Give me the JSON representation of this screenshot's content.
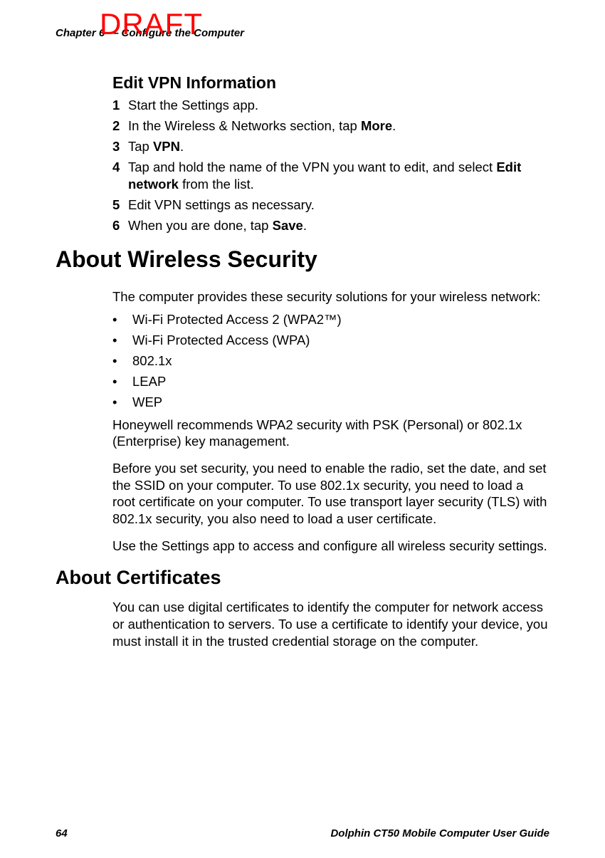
{
  "watermark": "DRAFT",
  "chapter_header": "Chapter 6 — Configure the Computer",
  "section1": {
    "heading": "Edit VPN Information",
    "steps": [
      {
        "num": "1",
        "segments": [
          {
            "t": "Start the Settings app."
          }
        ]
      },
      {
        "num": "2",
        "segments": [
          {
            "t": "In the Wireless & Networks section, tap "
          },
          {
            "t": "More",
            "b": true
          },
          {
            "t": "."
          }
        ]
      },
      {
        "num": "3",
        "segments": [
          {
            "t": "Tap "
          },
          {
            "t": "VPN",
            "b": true
          },
          {
            "t": "."
          }
        ]
      },
      {
        "num": "4",
        "segments": [
          {
            "t": "Tap and hold the name of the VPN you want to edit, and select "
          },
          {
            "t": "Edit network",
            "b": true
          },
          {
            "t": " from the list."
          }
        ]
      },
      {
        "num": "5",
        "segments": [
          {
            "t": "Edit VPN settings as necessary."
          }
        ]
      },
      {
        "num": "6",
        "segments": [
          {
            "t": "When you are done, tap "
          },
          {
            "t": "Save",
            "b": true
          },
          {
            "t": "."
          }
        ]
      }
    ]
  },
  "section2": {
    "heading": "About Wireless Security",
    "intro": "The computer provides these security solutions for your wireless network:",
    "bullets": [
      "Wi-Fi Protected Access 2 (WPA2™)",
      "Wi-Fi Protected Access (WPA)",
      "802.1x",
      "LEAP",
      "WEP"
    ],
    "para1": "Honeywell recommends WPA2 security with PSK (Personal) or 802.1x (Enterprise) key management.",
    "para2": "Before you set security, you need to enable the radio, set the date, and set the SSID on your computer. To use 802.1x security, you need to load a root certificate on your computer. To use transport layer security (TLS) with 802.1x security, you also need to load a user certificate.",
    "para3": "Use the Settings app to access and configure all wireless security settings."
  },
  "section3": {
    "heading": "About Certificates",
    "para1": "You can use digital certificates to identify the computer for network access or authentication to servers. To use a certificate to identify your device, you must install it in the trusted credential storage on the computer."
  },
  "footer": {
    "page_number": "64",
    "doc_title": "Dolphin CT50 Mobile Computer User Guide"
  }
}
